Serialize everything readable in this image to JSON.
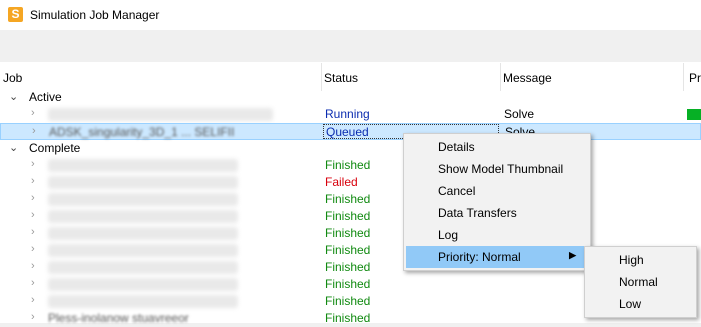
{
  "window": {
    "title": "Simulation Job Manager",
    "icon": "S"
  },
  "columns": [
    "Job",
    "Status",
    "Message",
    "Pr"
  ],
  "groups": {
    "active": {
      "title": "Active"
    },
    "complete": {
      "title": "Complete"
    }
  },
  "active_rows": [
    {
      "status": "Running",
      "message": "Solve",
      "progress": 1.0
    },
    {
      "job": "ADSK_singularity_3D_1 ... SELIFII",
      "status": "Queued",
      "message": "Solve"
    }
  ],
  "complete_rows": [
    {
      "status": "Finished"
    },
    {
      "status": "Failed"
    },
    {
      "status": "Finished"
    },
    {
      "status": "Finished"
    },
    {
      "status": "Finished"
    },
    {
      "status": "Finished"
    },
    {
      "status": "Finished"
    },
    {
      "status": "Finished"
    },
    {
      "status": "Finished"
    },
    {
      "status": "Finished",
      "job": "Pless-inolanow stuavreeor"
    }
  ],
  "context_menu": {
    "items": [
      "Details",
      "Show Model Thumbnail",
      "Cancel",
      "Data Transfers",
      "Log",
      "Priority: Normal"
    ],
    "submenu": [
      "High",
      "Normal",
      "Low"
    ]
  }
}
